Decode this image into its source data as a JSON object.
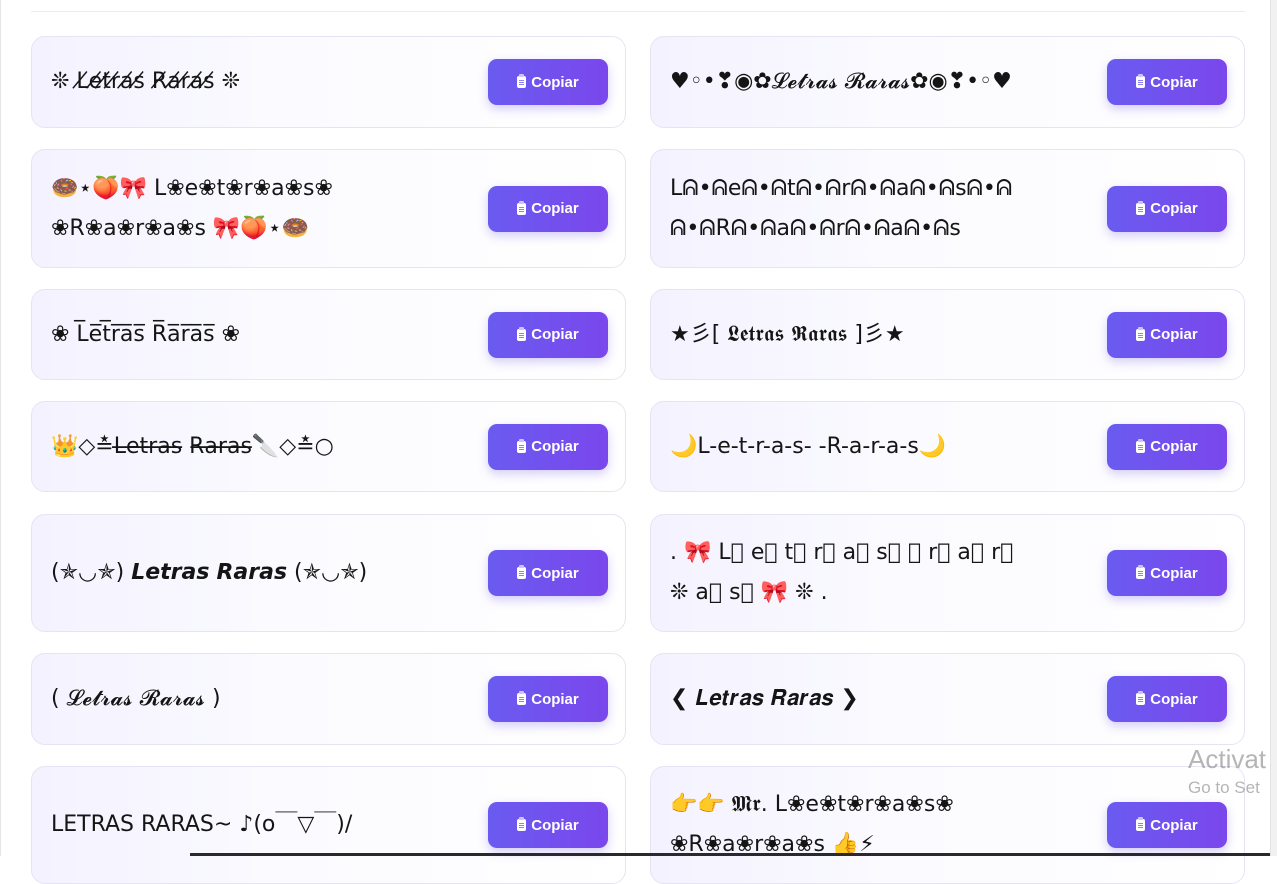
{
  "copy_button_label": "Copiar",
  "colors": {
    "button_start": "#6a5bf0",
    "button_end": "#7a47ec",
    "card_border": "#e6e4f3"
  },
  "icons": {
    "copy": "clipboard-icon"
  },
  "styles": [
    [
      "❊ L̸e̸t̸r̸a̸s̸ R̸a̸r̸a̸s̸ ❊",
      "♥◦•❣◉✿𝓛𝓮𝓽𝓻𝓪𝓼 𝓡𝓪𝓻𝓪𝓼✿◉❣•◦♥"
    ],
    [
      "🍩⋆🍑🎀 L❀e❀t❀r❀a❀s❀\n❀R❀a❀r❀a❀s 🎀🍑⋆🍩",
      "Lᕱ•ᕱeᕱ•ᕱtᕱ•ᕱrᕱ•ᕱaᕱ•ᕱsᕱ•ᕱ\nᕱ•ᕱRᕱ•ᕱaᕱ•ᕱrᕱ•ᕱaᕱ•ᕱs"
    ],
    [
      "❀ L̅e̅t̅r̅a̅s̅ R̅a̅r̅a̅s̅ ❀",
      "★彡[ 𝕷𝖊𝖙𝖗𝖆𝖘 𝕽𝖆𝖗𝖆𝖘 ]彡★"
    ],
    [
      "👑◇≛L̶e̶t̶r̶a̶s̶ R̶a̶r̶a̶s̶🔪◇≛○",
      "🌙L-e-t-r-a-s- -R-a-r-a-s🌙"
    ],
    [
      "(✯◡✯) 𝙇𝙚𝙩𝙧𝙖𝙨 𝙍𝙖𝙧𝙖𝙨 (✯◡✯)",
      ". 🎀 L⃟ e⃟ t⃟ r⃟ a⃟ s⃟ ⃟ r⃟ a⃟ r⃟\n❊ a⃟ s⃟ 🎀 ❊ ."
    ],
    [
      "( 𝓛𝓮𝓽𝓻𝓪𝓼 𝓡𝓪𝓻𝓪𝓼 )",
      "❮ 𝑳𝒆𝒕𝒓𝒂𝒔 𝑹𝒂𝒓𝒂𝒔 ❯"
    ],
    [
      "LETRAS RARAS~ ♪(o￣▽￣)/",
      "👉👉 𝕸𝖗. L❀e❀t❀r❀a❀s❀\n❀R❀a❀r❀a❀s 👍⚡"
    ]
  ],
  "watermark": {
    "title": "Activat",
    "subtitle": "Go to Set"
  }
}
